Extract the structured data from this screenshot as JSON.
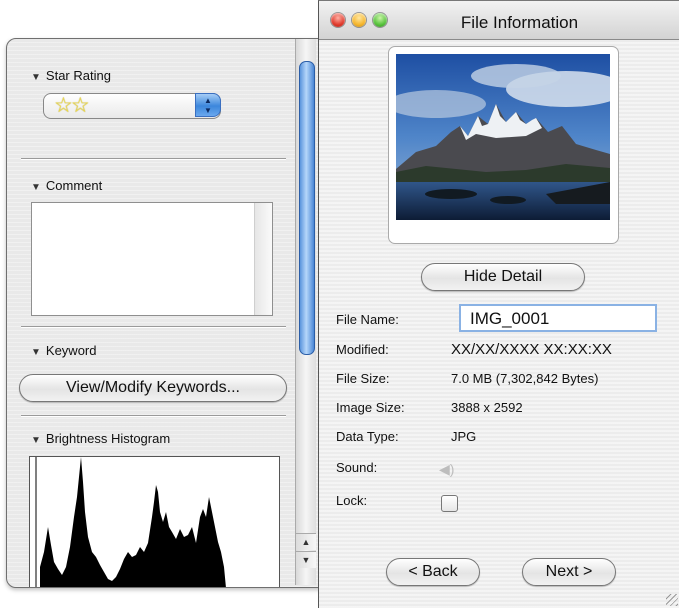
{
  "window": {
    "title": "File Information"
  },
  "drawer": {
    "star_rating": {
      "label": "Star Rating",
      "value": 2,
      "stars": "☆☆"
    },
    "comment": {
      "label": "Comment",
      "value": ""
    },
    "keyword": {
      "label": "Keyword",
      "button_label": "View/Modify Keywords..."
    },
    "histogram": {
      "label": "Brightness Histogram"
    }
  },
  "preview": {
    "hide_detail_label": "Hide Detail"
  },
  "details": {
    "file_name_label": "File Name:",
    "file_name_value": "IMG_0001",
    "modified_label": "Modified:",
    "modified_value": "XX/XX/XXXX XX:XX:XX",
    "file_size_label": "File Size:",
    "file_size_value": "7.0 MB (7,302,842 Bytes)",
    "image_size_label": "Image Size:",
    "image_size_value": "3888 x 2592",
    "data_type_label": "Data Type:",
    "data_type_value": "JPG",
    "sound_label": "Sound:",
    "lock_label": "Lock:",
    "lock_checked": false
  },
  "nav": {
    "back_label": "< Back",
    "next_label": "Next >"
  },
  "colors": {
    "accent": "#3c87dc",
    "focus_ring": "#8ab2e4",
    "star": "#f2e04a"
  },
  "icons": {
    "sound": "speaker-icon",
    "disclosure": "disclosure-triangle-icon"
  }
}
